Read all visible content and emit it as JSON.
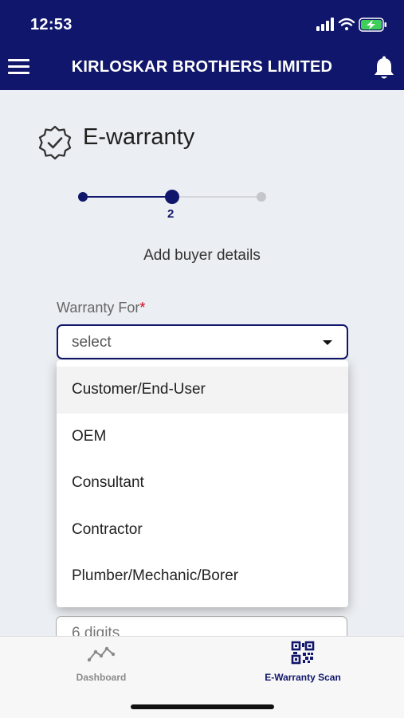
{
  "status_bar": {
    "time": "12:53"
  },
  "header": {
    "title": "KIRLOSKAR BROTHERS LIMITED",
    "menu_icon": "hamburger-menu-icon",
    "notification_icon": "bell-icon"
  },
  "page": {
    "title": "E-warranty",
    "title_icon": "verified-badge-icon"
  },
  "stepper": {
    "current_step": "2",
    "caption": "Add buyer details"
  },
  "form": {
    "warranty_for": {
      "label": "Warranty For",
      "required_mark": "*",
      "placeholder": "select"
    },
    "partial_field": {
      "placeholder": "6 digits"
    }
  },
  "dropdown": {
    "options": [
      "Customer/End-User",
      "OEM",
      "Consultant",
      "Contractor",
      "Plumber/Mechanic/Borer"
    ]
  },
  "bottom_nav": {
    "tabs": [
      {
        "label": "Dashboard",
        "icon": "line-chart-icon",
        "active": false
      },
      {
        "label": "E-Warranty Scan",
        "icon": "qr-code-icon",
        "active": true
      }
    ]
  },
  "colors": {
    "primary": "#10166b",
    "background": "#ebeef2",
    "required": "#d0021b",
    "inactive": "#8a8a8a"
  }
}
